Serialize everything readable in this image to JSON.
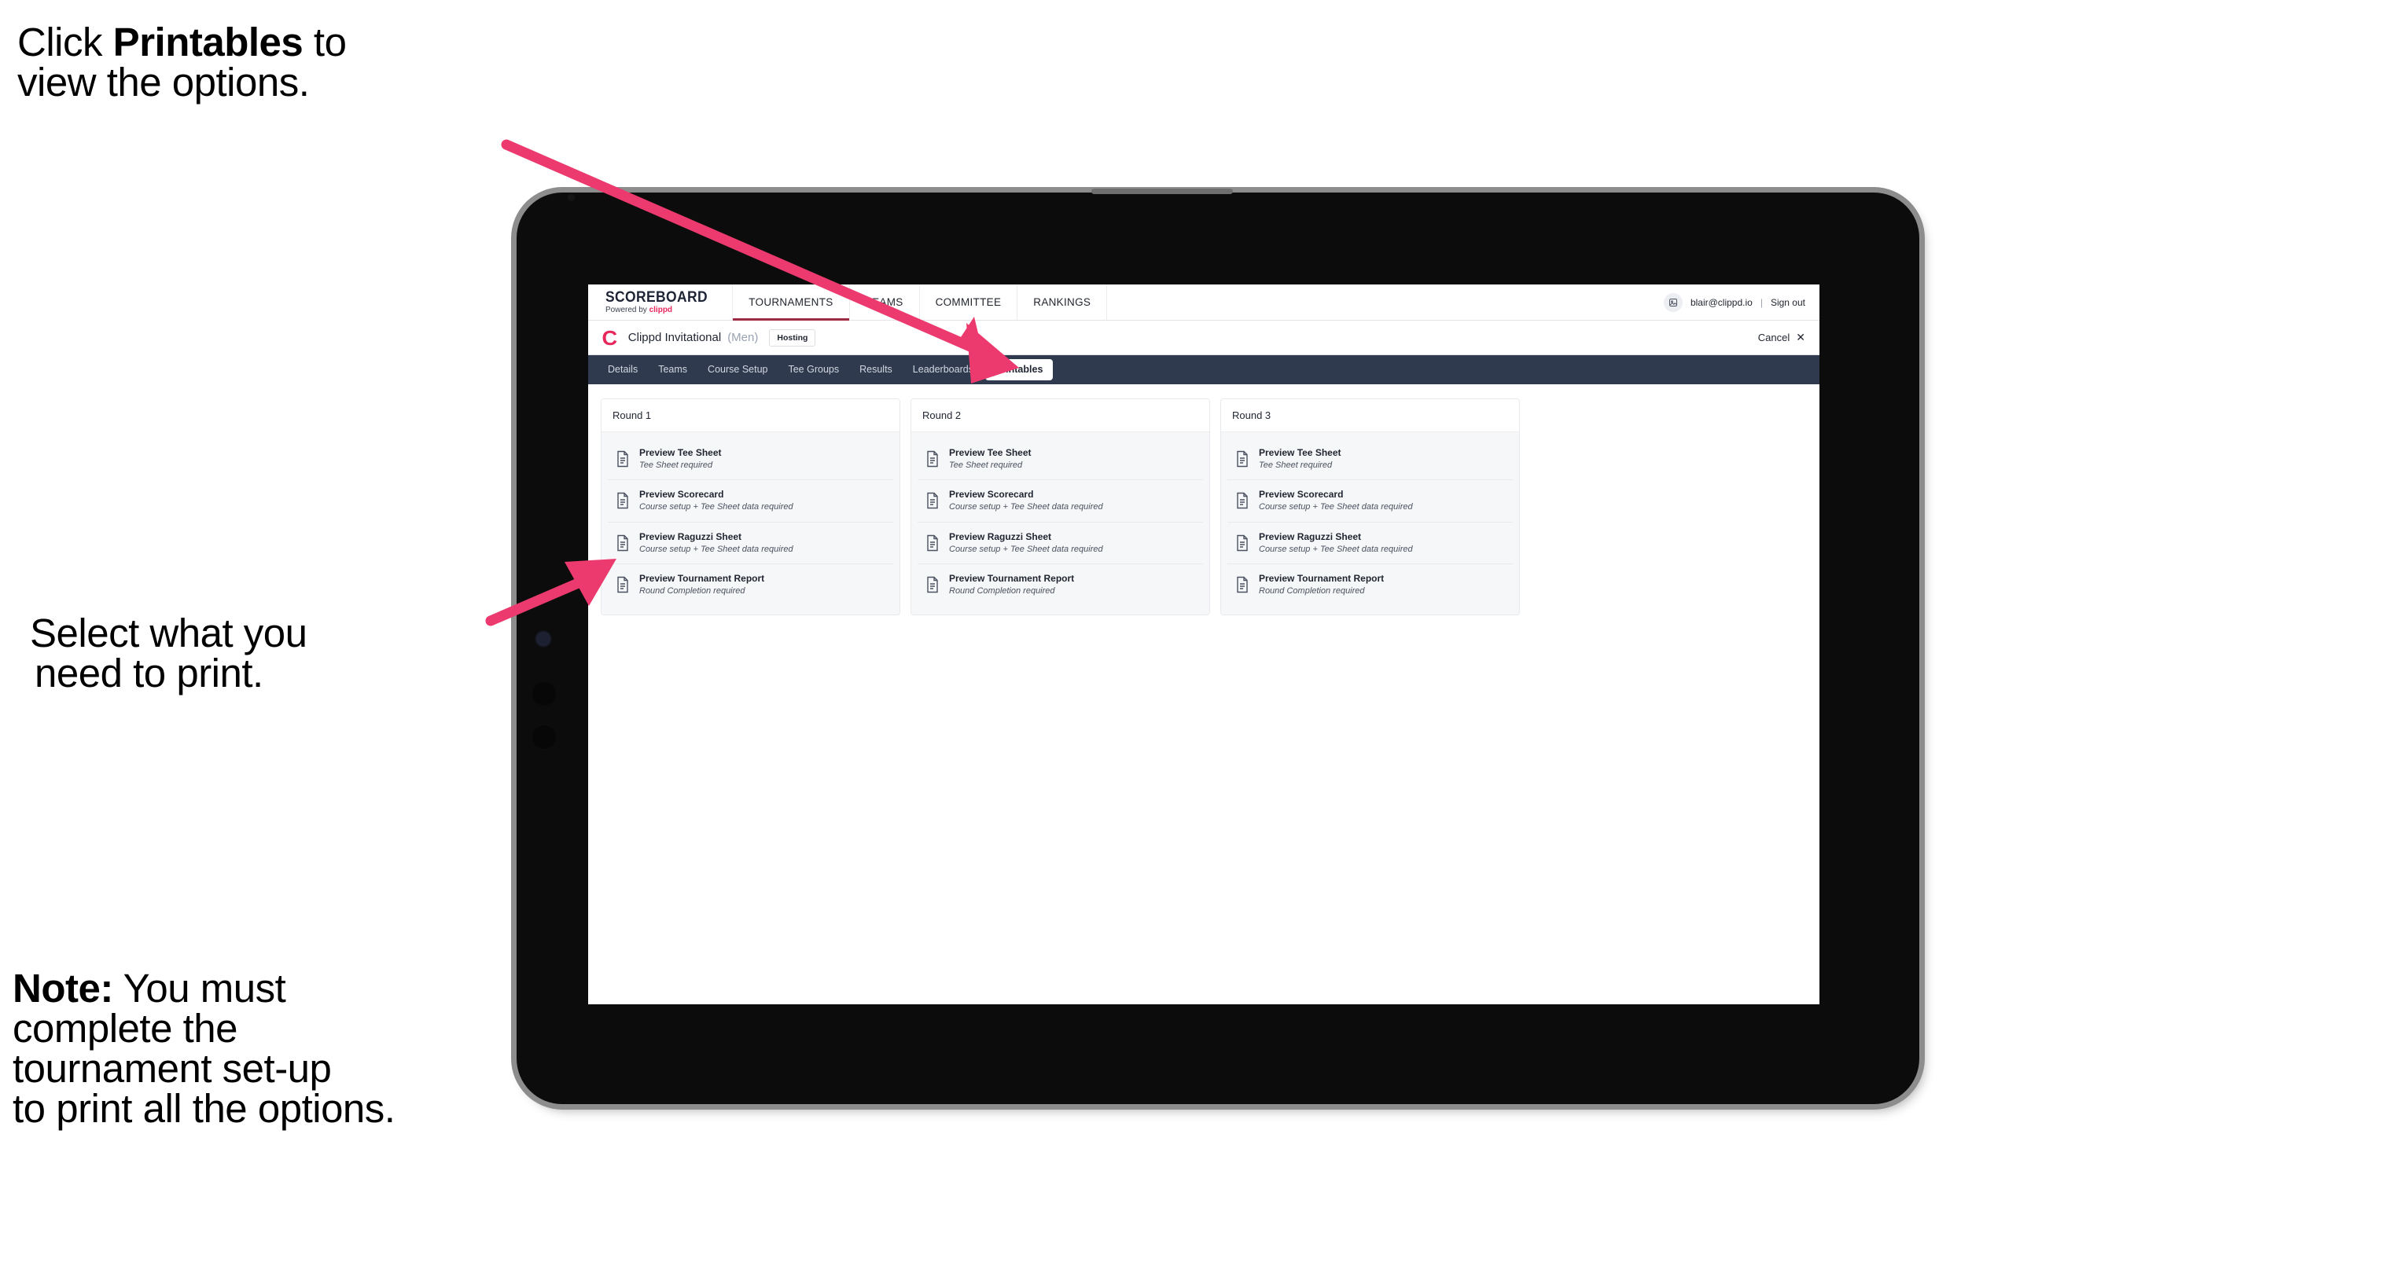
{
  "annotations": {
    "top": {
      "pre": "Click ",
      "bold": "Printables",
      "post": " to",
      "line2": "view the options."
    },
    "middle": {
      "line1": "Select what you",
      "line2": "need to print."
    },
    "note": {
      "bold": "Note:",
      "line1_rest": " You must",
      "line2": "complete the",
      "line3": "tournament set-up",
      "line4": "to print all the options."
    }
  },
  "colors": {
    "accent_pink": "#e8275a",
    "nav_underline": "#9d2b45",
    "tabstrip_bg": "#2f3a4e",
    "arrow": "#ec3a6e",
    "device_frame": "#8d8d8d",
    "device_body": "#0c0c0c"
  },
  "app": {
    "brand": {
      "main": "SCOREBOARD",
      "sub_prefix": "Powered by ",
      "sub_brand": "clippd"
    },
    "nav_items": [
      {
        "label": "TOURNAMENTS",
        "active": true
      },
      {
        "label": "TEAMS",
        "active": false
      },
      {
        "label": "COMMITTEE",
        "active": false
      },
      {
        "label": "RANKINGS",
        "active": false
      }
    ],
    "account": {
      "avatar_icon": "user-avatar-icon",
      "email": "blair@clippd.io",
      "separator": "|",
      "sign_out": "Sign out"
    },
    "subheader": {
      "logo_letter": "C",
      "tournament_name": "Clippd Invitational",
      "gender": "(Men)",
      "badge": "Hosting",
      "cancel_label": "Cancel",
      "cancel_icon": "close-icon"
    },
    "tabs": [
      {
        "label": "Details",
        "active": false
      },
      {
        "label": "Teams",
        "active": false
      },
      {
        "label": "Course Setup",
        "active": false
      },
      {
        "label": "Tee Groups",
        "active": false
      },
      {
        "label": "Results",
        "active": false
      },
      {
        "label": "Leaderboards",
        "active": false
      },
      {
        "label": "Printables",
        "active": true
      }
    ],
    "rounds": [
      {
        "title": "Round 1",
        "items": [
          {
            "title": "Preview Tee Sheet",
            "sub": "Tee Sheet required"
          },
          {
            "title": "Preview Scorecard",
            "sub": "Course setup + Tee Sheet data required"
          },
          {
            "title": "Preview Raguzzi Sheet",
            "sub": "Course setup + Tee Sheet data required"
          },
          {
            "title": "Preview Tournament Report",
            "sub": "Round Completion required"
          }
        ]
      },
      {
        "title": "Round 2",
        "items": [
          {
            "title": "Preview Tee Sheet",
            "sub": "Tee Sheet required"
          },
          {
            "title": "Preview Scorecard",
            "sub": "Course setup + Tee Sheet data required"
          },
          {
            "title": "Preview Raguzzi Sheet",
            "sub": "Course setup + Tee Sheet data required"
          },
          {
            "title": "Preview Tournament Report",
            "sub": "Round Completion required"
          }
        ]
      },
      {
        "title": "Round 3",
        "items": [
          {
            "title": "Preview Tee Sheet",
            "sub": "Tee Sheet required"
          },
          {
            "title": "Preview Scorecard",
            "sub": "Course setup + Tee Sheet data required"
          },
          {
            "title": "Preview Raguzzi Sheet",
            "sub": "Course setup + Tee Sheet data required"
          },
          {
            "title": "Preview Tournament Report",
            "sub": "Round Completion required"
          }
        ]
      }
    ]
  }
}
